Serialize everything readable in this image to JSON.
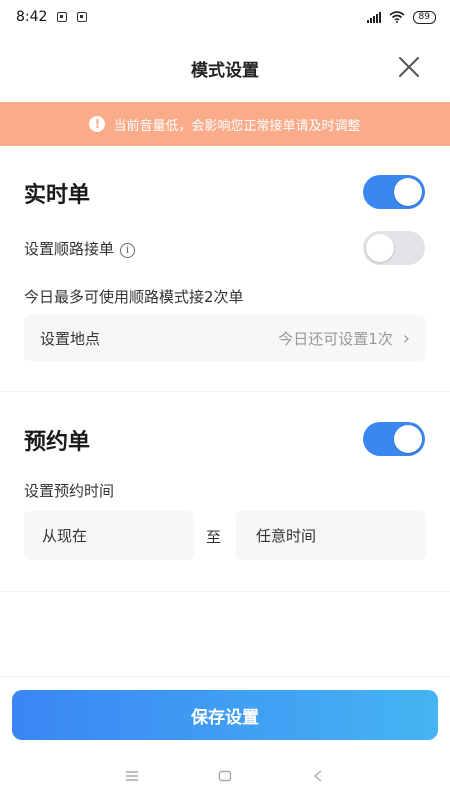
{
  "status_bar": {
    "time": "8:42",
    "battery": "89"
  },
  "header": {
    "title": "模式设置"
  },
  "banner": {
    "icon": "!",
    "text": "当前音量低，会影响您正常接单请及时调整"
  },
  "realtime": {
    "title": "实时单",
    "enabled": true,
    "route_label": "设置顺路接单",
    "route_info_icon": "i",
    "route_enabled": false,
    "quota_text": "今日最多可使用顺路模式接2次单",
    "location_label": "设置地点",
    "location_hint": "今日还可设置1次",
    "chevron": "›"
  },
  "reservation": {
    "title": "预约单",
    "enabled": true,
    "time_label": "设置预约时间",
    "from": "从现在",
    "separator": "至",
    "to": "任意时间"
  },
  "footer": {
    "save_label": "保存设置"
  },
  "colors": {
    "accent": "#3a87f0",
    "banner": "#f9ab8a",
    "toggle_off": "#e2e3e7"
  }
}
